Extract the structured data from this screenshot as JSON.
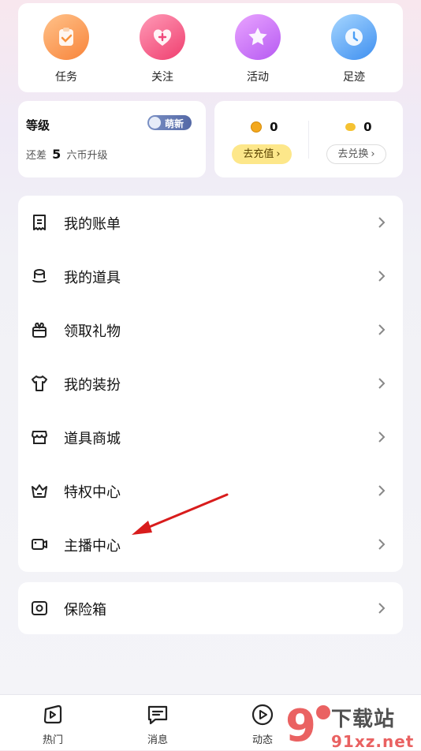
{
  "quick_actions": [
    {
      "label": "任务",
      "icon": "task-clipboard-icon",
      "color": "#f8923c"
    },
    {
      "label": "关注",
      "icon": "heart-plus-icon",
      "color": "#f0467a"
    },
    {
      "label": "活动",
      "icon": "star-icon",
      "color": "#c35af4"
    },
    {
      "label": "足迹",
      "icon": "clock-icon",
      "color": "#4a9ef5"
    }
  ],
  "level": {
    "title": "等级",
    "badge": "萌新",
    "prefix": "还差",
    "amount": "5",
    "suffix": "六币升级"
  },
  "wallet": {
    "coins": {
      "value": "0",
      "button": "去充值"
    },
    "points": {
      "value": "0",
      "button": "去兑换"
    }
  },
  "menu": [
    {
      "label": "我的账单",
      "icon": "bill-icon"
    },
    {
      "label": "我的道具",
      "icon": "hat-icon"
    },
    {
      "label": "领取礼物",
      "icon": "gift-icon"
    },
    {
      "label": "我的装扮",
      "icon": "tshirt-icon"
    },
    {
      "label": "道具商城",
      "icon": "store-icon"
    },
    {
      "label": "特权中心",
      "icon": "crown-icon"
    },
    {
      "label": "主播中心",
      "icon": "video-camera-icon"
    }
  ],
  "safe": {
    "label": "保险箱",
    "icon": "safe-icon"
  },
  "nav": [
    {
      "label": "热门",
      "icon": "play-hot-icon"
    },
    {
      "label": "消息",
      "icon": "message-icon"
    },
    {
      "label": "动态",
      "icon": "play-circle-icon"
    }
  ],
  "watermark": "下载站 91xz.net"
}
